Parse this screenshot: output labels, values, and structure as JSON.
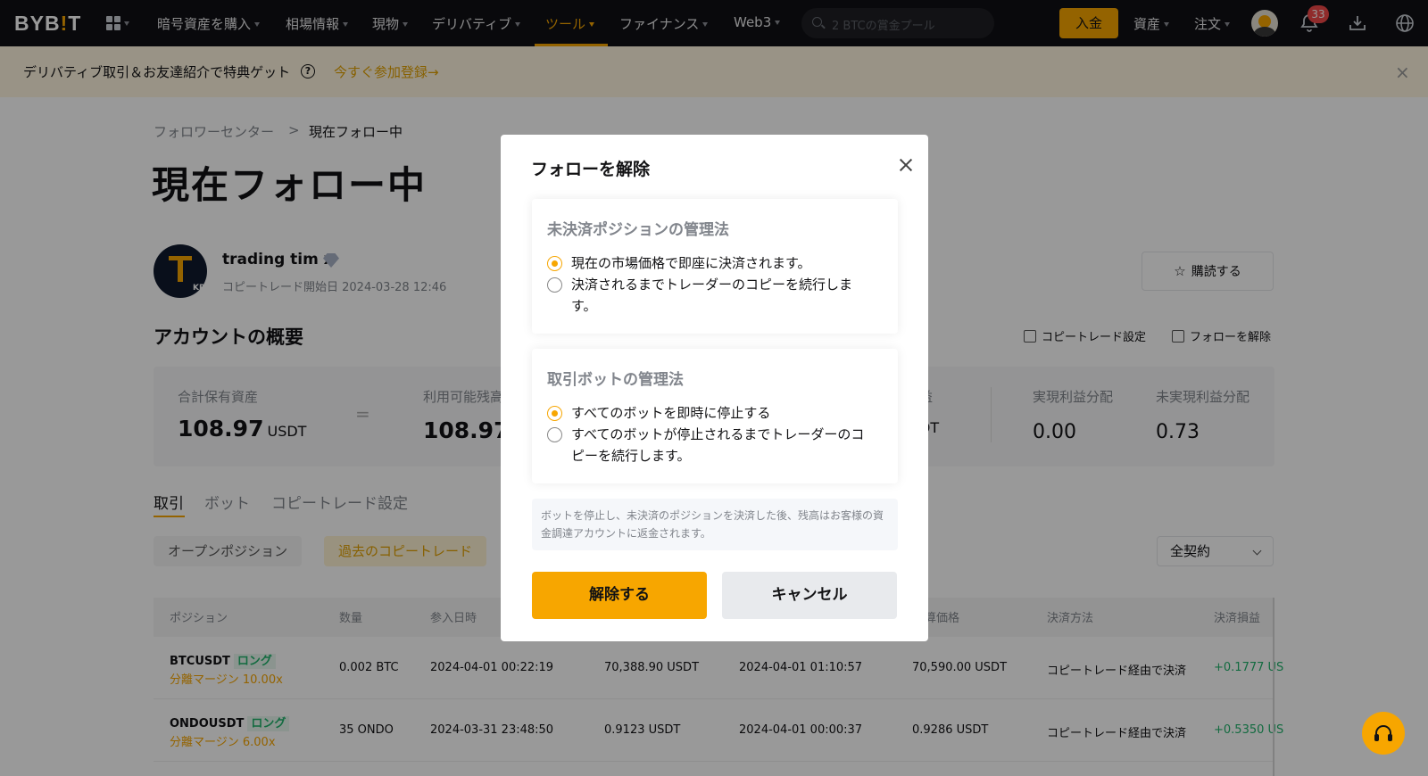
{
  "nav": {
    "logo_left": "BYB",
    "logo_bar": "!",
    "logo_right": "T",
    "items": [
      {
        "label": "暗号資産を購入"
      },
      {
        "label": "相場情報"
      },
      {
        "label": "現物"
      },
      {
        "label": "デリバティブ"
      },
      {
        "label": "ツール"
      },
      {
        "label": "ファイナンス"
      },
      {
        "label": "Web3"
      }
    ],
    "search_placeholder": "2 BTCの賞金プール",
    "deposit_label": "入金",
    "assets_label": "資産",
    "orders_label": "注文",
    "notification_count": "33",
    "accent_color": "#f7a600"
  },
  "promo": {
    "text": "デリバティブ取引＆お友達紹介で特典ゲット",
    "help_glyph": "?",
    "cta": "今すぐ参加登録→",
    "close_glyph": "×"
  },
  "page": {
    "breadcrumb_parent": "フォロワーセンター",
    "breadcrumb_sep": ">",
    "breadcrumb_current": "現在フォロー中",
    "title": "現在フォロー中",
    "trader": {
      "name": "trading tim x",
      "region": "KR",
      "start_label": "コピートレード開始日 2024-03-28 12:46"
    },
    "subscribe_label": "購読する",
    "overview_title": "アカウントの概要",
    "copytrade_settings_link": "コピートレード設定",
    "unfollow_link": "フォローを解除",
    "stats": {
      "total_label": "合計保有資産",
      "total_value": "108.97",
      "total_unit": "USDT",
      "eq_sign": "=",
      "available_label": "利用可能残高",
      "available_value": "108.97",
      "available_unit": "U",
      "hidden_label_tail": "益",
      "hidden_unit_tail": "DT",
      "realized_label": "実現利益分配",
      "realized_value": "0.00",
      "unrealized_label": "未実現利益分配",
      "unrealized_value": "0.73"
    },
    "tabs": [
      "取引",
      "ボット",
      "コピートレード設定"
    ],
    "subtabs": [
      "オープンポジション",
      "過去のコピートレード"
    ],
    "contract_select": "全契約",
    "table": {
      "headers": [
        "ポジション",
        "数量",
        "参入日時",
        "算価格",
        "決済方法",
        "決済損益"
      ],
      "rows": [
        {
          "symbol": "BTCUSDT",
          "side": "ロング",
          "margin": "分離マージン 10.00x",
          "qty": "0.002 BTC",
          "entry_time": "2024-04-01 00:22:19",
          "entry_price": "70,388.90 USDT",
          "close_time": "2024-04-01 01:10:57",
          "close_price": "70,590.00 USDT",
          "method": "コピートレード経由で決済",
          "pnl": "+0.1777 US"
        },
        {
          "symbol": "ONDOUSDT",
          "side": "ロング",
          "margin": "分離マージン 6.00x",
          "qty": "35 ONDO",
          "entry_time": "2024-03-31 23:48:50",
          "entry_price": "0.9123 USDT",
          "close_time": "2024-04-01 00:00:37",
          "close_price": "0.9286 USDT",
          "method": "コピートレード経由で決済",
          "pnl": "+0.5350 US"
        }
      ]
    }
  },
  "modal": {
    "title": "フォローを解除",
    "positions_section": {
      "heading": "未決済ポジションの管理法",
      "options": [
        {
          "label": "現在の市場価格で即座に決済されます。",
          "selected": true
        },
        {
          "label": "決済されるまでトレーダーのコピーを続行します。",
          "selected": false
        }
      ]
    },
    "bots_section": {
      "heading": "取引ボットの管理法",
      "options": [
        {
          "label": "すべてのボットを即時に停止する",
          "selected": true
        },
        {
          "label": "すべてのボットが停止されるまでトレーダーのコピーを続行します。",
          "selected": false
        }
      ]
    },
    "notice": "ボットを停止し、未決済のポジションを決済した後、残高はお客様の資金調達アカウントに返金されます。",
    "confirm_label": "解除する",
    "cancel_label": "キャンセル"
  }
}
